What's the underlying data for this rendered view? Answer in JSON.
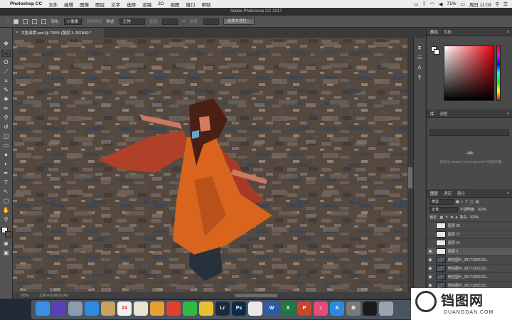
{
  "menubar": {
    "apple": "",
    "app_name": "Photoshop CC",
    "items": [
      "文件",
      "编辑",
      "图像",
      "图层",
      "文字",
      "选择",
      "滤镜",
      "3D",
      "视图",
      "窗口",
      "帮助"
    ],
    "battery": "71%",
    "clock": "周日 11:03"
  },
  "window_title": "Adobe Photoshop CC 2017",
  "options": {
    "feather_label": "羽化:",
    "feather_value": "0 像素",
    "antialias": "消除锯齿",
    "style_label": "样式:",
    "style_value": "正常",
    "width_label": "宽度:",
    "height_label": "高度:",
    "select_mask_button": "选择并遮住..."
  },
  "document": {
    "tab_title": "大鱼海棠.psd @ 700% (图层 3, RGB/8) *",
    "zoom": "700%",
    "doc_info": "文档:4.61M/76.9M"
  },
  "toolbar": {
    "icons": [
      "move-icon",
      "marquee-icon",
      "lasso-icon",
      "quick-select-icon",
      "crop-icon",
      "eyedropper-icon",
      "healing-icon",
      "brush-icon",
      "stamp-icon",
      "history-brush-icon",
      "eraser-icon",
      "gradient-icon",
      "blur-icon",
      "dodge-icon",
      "pen-icon",
      "type-icon",
      "path-select-icon",
      "shape-icon",
      "hand-icon",
      "zoom-icon"
    ],
    "glyphs": [
      "✥",
      "⬚",
      "ʘ",
      "⟋",
      "⌗",
      "✎",
      "✚",
      "✏",
      "⚲",
      "↺",
      "◫",
      "▭",
      "●",
      "◐",
      "✒",
      "T",
      "↖",
      "▢",
      "✋",
      "⚲"
    ]
  },
  "panels": {
    "color_tabs": [
      "颜色",
      "色板"
    ],
    "library_tabs": [
      "库",
      "调整"
    ],
    "library_message": "初始化 Creative Cloud Libraries 时出现问题",
    "layers_tabs": [
      "图层",
      "通道",
      "路径"
    ],
    "kind_filter": "类型",
    "blend_mode": "正常",
    "opacity_label": "不透明度:",
    "opacity_value": "100%",
    "lock_label": "锁定:",
    "fill_label": "填充:",
    "fill_value": "100%",
    "layers": [
      {
        "name": "图层 20",
        "visible": false,
        "thumb": "white",
        "selected": false
      },
      {
        "name": "图层 12",
        "visible": false,
        "thumb": "white",
        "selected": false
      },
      {
        "name": "图层 14",
        "visible": false,
        "thumb": "white",
        "selected": false
      },
      {
        "name": "图层 3",
        "visible": true,
        "thumb": "white",
        "selected": true
      },
      {
        "name": "微信图片_20171202131...",
        "visible": true,
        "thumb": "photo",
        "selected": false
      },
      {
        "name": "微信图片_20171202131...",
        "visible": true,
        "thumb": "photo",
        "selected": false
      },
      {
        "name": "微信图片_20171202131...",
        "visible": true,
        "thumb": "photo",
        "selected": false
      },
      {
        "name": "微信图片_20171202131...",
        "visible": true,
        "thumb": "photo",
        "selected": false
      },
      {
        "name": "微信图片_20171202131...",
        "visible": true,
        "thumb": "photo",
        "selected": false
      }
    ]
  },
  "dock": {
    "apps": [
      {
        "name": "finder-icon",
        "label": "",
        "color": "#3a8ee6"
      },
      {
        "name": "siri-icon",
        "label": "",
        "color": "#5b3fb8"
      },
      {
        "name": "launchpad-icon",
        "label": "",
        "color": "#8b9bb0"
      },
      {
        "name": "safari-icon",
        "label": "",
        "color": "#2b8be0"
      },
      {
        "name": "notes-icon",
        "label": "",
        "color": "#c8a060"
      },
      {
        "name": "calendar-icon",
        "label": "24",
        "color": "#f2f2f2"
      },
      {
        "name": "stickies-icon",
        "label": "",
        "color": "#e8e4d0"
      },
      {
        "name": "photos-icon",
        "label": "",
        "color": "#e8a030"
      },
      {
        "name": "weibo-icon",
        "label": "",
        "color": "#e04030"
      },
      {
        "name": "wechat-icon",
        "label": "",
        "color": "#2dbb43"
      },
      {
        "name": "qq-icon",
        "label": "",
        "color": "#e8c030"
      },
      {
        "name": "lightroom-icon",
        "label": "Lr",
        "color": "#1e2a3a"
      },
      {
        "name": "photoshop-icon",
        "label": "Ps",
        "color": "#0b2a4a"
      },
      {
        "name": "pse-icon",
        "label": "",
        "color": "#e8e8e8"
      },
      {
        "name": "word-icon",
        "label": "W",
        "color": "#2b5ca8"
      },
      {
        "name": "excel-icon",
        "label": "X",
        "color": "#1f7a3f"
      },
      {
        "name": "powerpoint-icon",
        "label": "P",
        "color": "#c8462a"
      },
      {
        "name": "itunes-icon",
        "label": "♫",
        "color": "#e84a7a"
      },
      {
        "name": "appstore-icon",
        "label": "A",
        "color": "#2b8be0"
      },
      {
        "name": "preferences-icon",
        "label": "⚙",
        "color": "#7a7a7a"
      },
      {
        "name": "monitor-icon",
        "label": "",
        "color": "#1a1a1a"
      },
      {
        "name": "trash-icon",
        "label": "",
        "color": "#9aa4b0"
      }
    ]
  },
  "watermark": {
    "main": "铛图网",
    "sub": "DUANGDAN.COM"
  },
  "colors": {
    "canvas_bg": "#554a45",
    "dress": "#d8641e",
    "scarf": "#b04028",
    "hair": "#4a2016",
    "skin": "#d77a5a",
    "ui_dark": "#3c3c3c",
    "ui_mid": "#535353"
  }
}
